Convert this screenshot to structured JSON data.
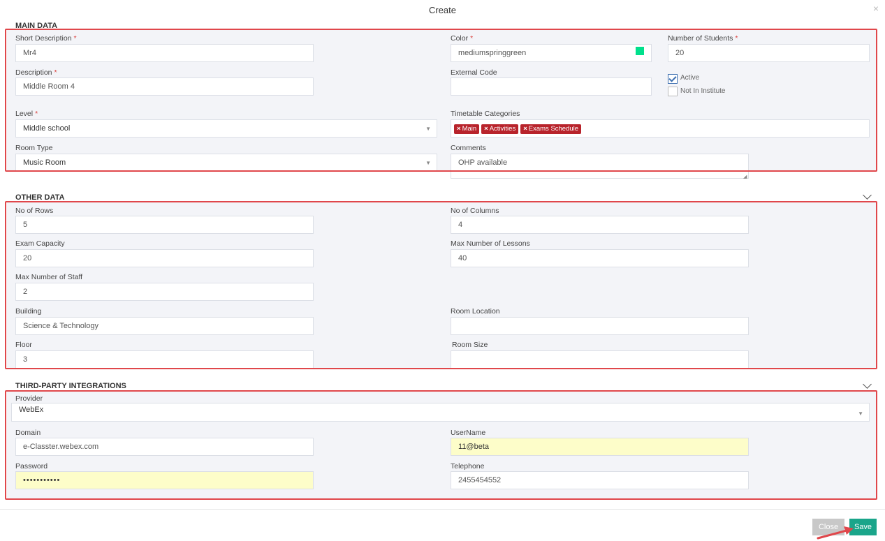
{
  "modal": {
    "title": "Create",
    "close_icon": "close-icon"
  },
  "main_data": {
    "title": "MAIN DATA",
    "short_description": {
      "label": "Short Description",
      "required": "*",
      "value": "Mr4"
    },
    "description": {
      "label": "Description",
      "required": "*",
      "value": "Middle Room 4"
    },
    "level": {
      "label": "Level",
      "required": "*",
      "value": "Middle school"
    },
    "room_type": {
      "label": "Room Type",
      "value": "Music Room"
    },
    "color": {
      "label": "Color",
      "required": "*",
      "value": "mediumspringgreen",
      "swatch": "#00e08c"
    },
    "external_code": {
      "label": "External Code",
      "value": ""
    },
    "timetable_categories": {
      "label": "Timetable Categories",
      "tags": [
        "Main",
        "Activities",
        "Exams Schedule"
      ],
      "tag_remove": "×"
    },
    "comments": {
      "label": "Comments",
      "value": "OHP available"
    },
    "number_of_students": {
      "label": "Number of Students",
      "required": "*",
      "value": "20"
    },
    "active": {
      "label": "Active",
      "checked": true
    },
    "not_in_institute": {
      "label": "Not In Institute",
      "checked": false
    }
  },
  "other_data": {
    "title": "OTHER DATA",
    "no_of_rows": {
      "label": "No of Rows",
      "value": "5"
    },
    "no_of_columns": {
      "label": "No of Columns",
      "value": "4"
    },
    "exam_capacity": {
      "label": "Exam Capacity",
      "value": "20"
    },
    "max_lessons": {
      "label": "Max Number of Lessons",
      "value": "40"
    },
    "max_staff": {
      "label": "Max Number of Staff",
      "value": "2"
    },
    "building": {
      "label": "Building",
      "value": "Science & Technology"
    },
    "room_location": {
      "label": "Room Location",
      "value": ""
    },
    "floor": {
      "label": "Floor",
      "value": "3"
    },
    "room_size": {
      "label": "Room Size",
      "value": ""
    }
  },
  "integrations": {
    "title": "THIRD-PARTY INTEGRATIONS",
    "provider": {
      "label": "Provider",
      "value": "WebEx"
    },
    "domain": {
      "label": "Domain",
      "value": "e-Classter.webex.com"
    },
    "username": {
      "label": "UserName",
      "value": "11@beta"
    },
    "password": {
      "label": "Password",
      "value": "•••••••••••"
    },
    "telephone": {
      "label": "Telephone",
      "value": "2455454552"
    }
  },
  "footer": {
    "close_label": "Close",
    "save_label": "Save"
  },
  "colors": {
    "highlight_border": "#e0474b",
    "tag_bg": "#b8232b",
    "save_bg": "#1aa58a",
    "autofill_bg": "#fdfdc9"
  }
}
